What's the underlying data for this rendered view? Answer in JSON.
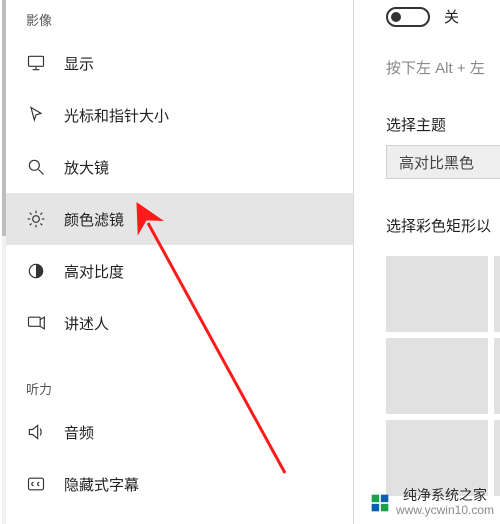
{
  "sidebar": {
    "section_vision": "影像",
    "section_hearing": "听力",
    "items": {
      "display": {
        "label": "显示"
      },
      "cursor": {
        "label": "光标和指针大小"
      },
      "magnifier": {
        "label": "放大镜"
      },
      "color_filters": {
        "label": "颜色滤镜"
      },
      "high_contrast": {
        "label": "高对比度"
      },
      "narrator": {
        "label": "讲述人"
      },
      "audio": {
        "label": "音频"
      },
      "closed_caption": {
        "label": "隐藏式字幕"
      }
    }
  },
  "panel": {
    "toggle_label": "关",
    "hint": "按下左 Alt + 左",
    "theme_heading": "选择主题",
    "theme_value": "高对比黑色",
    "preview_heading": "选择彩色矩形以"
  },
  "watermark": {
    "name": "纯净系统之家",
    "url": "www.ycwin10.com"
  }
}
